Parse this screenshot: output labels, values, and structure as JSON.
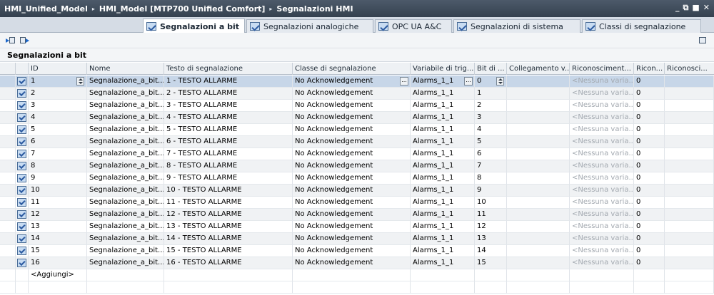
{
  "title": {
    "crumbs": [
      "HMI_Unified_Model",
      "HMI_Model [MTP700 Unified Comfort]",
      "Segnalazioni HMI"
    ],
    "separator": "▸",
    "controls": [
      "_",
      "⧉",
      "■",
      "✕"
    ]
  },
  "tabs": [
    {
      "label": "Segnalazioni a bit",
      "active": true
    },
    {
      "label": "Segnalazioni analogiche",
      "active": false
    },
    {
      "label": "OPC UA A&C",
      "active": false
    },
    {
      "label": "Segnalazioni di sistema",
      "active": false
    },
    {
      "label": "Classi di segnalazione",
      "active": false
    }
  ],
  "toolbar": {
    "icons": [
      "import-icon",
      "export-icon",
      "panel-toggle-icon"
    ]
  },
  "section_title": "Segnalazioni a bit",
  "table": {
    "columns": [
      "ID",
      "Nome",
      "Testo di segnalazione",
      "Classe di segnalazione",
      "Variabile di trig...",
      "Bit di ...",
      "Collegamento v...",
      "Riconosciment...",
      "Ricon...",
      "Riconosci..."
    ],
    "rows": [
      {
        "id": "1",
        "name": "Segnalazione_a_bit...",
        "text": "1 - TESTO ALLARME",
        "class": "No Acknowledgement",
        "trigger": "Alarms_1_1",
        "bit": "0",
        "link": "",
        "ack": "<Nessuna varia...",
        "ack2": "0",
        "ack3": ""
      },
      {
        "id": "2",
        "name": "Segnalazione_a_bit...",
        "text": "2 - TESTO ALLARME",
        "class": "No Acknowledgement",
        "trigger": "Alarms_1_1",
        "bit": "1",
        "link": "",
        "ack": "<Nessuna varia...",
        "ack2": "0",
        "ack3": ""
      },
      {
        "id": "3",
        "name": "Segnalazione_a_bit...",
        "text": "3 - TESTO ALLARME",
        "class": "No Acknowledgement",
        "trigger": "Alarms_1_1",
        "bit": "2",
        "link": "",
        "ack": "<Nessuna varia...",
        "ack2": "0",
        "ack3": ""
      },
      {
        "id": "4",
        "name": "Segnalazione_a_bit...",
        "text": "4 - TESTO ALLARME",
        "class": "No Acknowledgement",
        "trigger": "Alarms_1_1",
        "bit": "3",
        "link": "",
        "ack": "<Nessuna varia...",
        "ack2": "0",
        "ack3": ""
      },
      {
        "id": "5",
        "name": "Segnalazione_a_bit...",
        "text": "5 - TESTO ALLARME",
        "class": "No Acknowledgement",
        "trigger": "Alarms_1_1",
        "bit": "4",
        "link": "",
        "ack": "<Nessuna varia...",
        "ack2": "0",
        "ack3": ""
      },
      {
        "id": "6",
        "name": "Segnalazione_a_bit...",
        "text": "6 - TESTO ALLARME",
        "class": "No Acknowledgement",
        "trigger": "Alarms_1_1",
        "bit": "5",
        "link": "",
        "ack": "<Nessuna varia...",
        "ack2": "0",
        "ack3": ""
      },
      {
        "id": "7",
        "name": "Segnalazione_a_bit...",
        "text": "7 - TESTO ALLARME",
        "class": "No Acknowledgement",
        "trigger": "Alarms_1_1",
        "bit": "6",
        "link": "",
        "ack": "<Nessuna varia...",
        "ack2": "0",
        "ack3": ""
      },
      {
        "id": "8",
        "name": "Segnalazione_a_bit...",
        "text": "8 - TESTO ALLARME",
        "class": "No Acknowledgement",
        "trigger": "Alarms_1_1",
        "bit": "7",
        "link": "",
        "ack": "<Nessuna varia...",
        "ack2": "0",
        "ack3": ""
      },
      {
        "id": "9",
        "name": "Segnalazione_a_bit...",
        "text": "9 - TESTO ALLARME",
        "class": "No Acknowledgement",
        "trigger": "Alarms_1_1",
        "bit": "8",
        "link": "",
        "ack": "<Nessuna varia...",
        "ack2": "0",
        "ack3": ""
      },
      {
        "id": "10",
        "name": "Segnalazione_a_bit...",
        "text": "10 - TESTO ALLARME",
        "class": "No Acknowledgement",
        "trigger": "Alarms_1_1",
        "bit": "9",
        "link": "",
        "ack": "<Nessuna varia...",
        "ack2": "0",
        "ack3": ""
      },
      {
        "id": "11",
        "name": "Segnalazione_a_bit...",
        "text": "11 - TESTO ALLARME",
        "class": "No Acknowledgement",
        "trigger": "Alarms_1_1",
        "bit": "10",
        "link": "",
        "ack": "<Nessuna varia...",
        "ack2": "0",
        "ack3": ""
      },
      {
        "id": "12",
        "name": "Segnalazione_a_bit...",
        "text": "12 - TESTO ALLARME",
        "class": "No Acknowledgement",
        "trigger": "Alarms_1_1",
        "bit": "11",
        "link": "",
        "ack": "<Nessuna varia...",
        "ack2": "0",
        "ack3": ""
      },
      {
        "id": "13",
        "name": "Segnalazione_a_bit...",
        "text": "13 - TESTO ALLARME",
        "class": "No Acknowledgement",
        "trigger": "Alarms_1_1",
        "bit": "12",
        "link": "",
        "ack": "<Nessuna varia...",
        "ack2": "0",
        "ack3": ""
      },
      {
        "id": "14",
        "name": "Segnalazione_a_bit...",
        "text": "14 - TESTO ALLARME",
        "class": "No Acknowledgement",
        "trigger": "Alarms_1_1",
        "bit": "13",
        "link": "",
        "ack": "<Nessuna varia...",
        "ack2": "0",
        "ack3": ""
      },
      {
        "id": "15",
        "name": "Segnalazione_a_bit...",
        "text": "15 - TESTO ALLARME",
        "class": "No Acknowledgement",
        "trigger": "Alarms_1_1",
        "bit": "14",
        "link": "",
        "ack": "<Nessuna varia...",
        "ack2": "0",
        "ack3": ""
      },
      {
        "id": "16",
        "name": "Segnalazione_a_bit...",
        "text": "16 - TESTO ALLARME",
        "class": "No Acknowledgement",
        "trigger": "Alarms_1_1",
        "bit": "15",
        "link": "",
        "ack": "<Nessuna varia...",
        "ack2": "0",
        "ack3": ""
      }
    ],
    "add_label": "<Aggiungi>",
    "dots_label": "..."
  }
}
